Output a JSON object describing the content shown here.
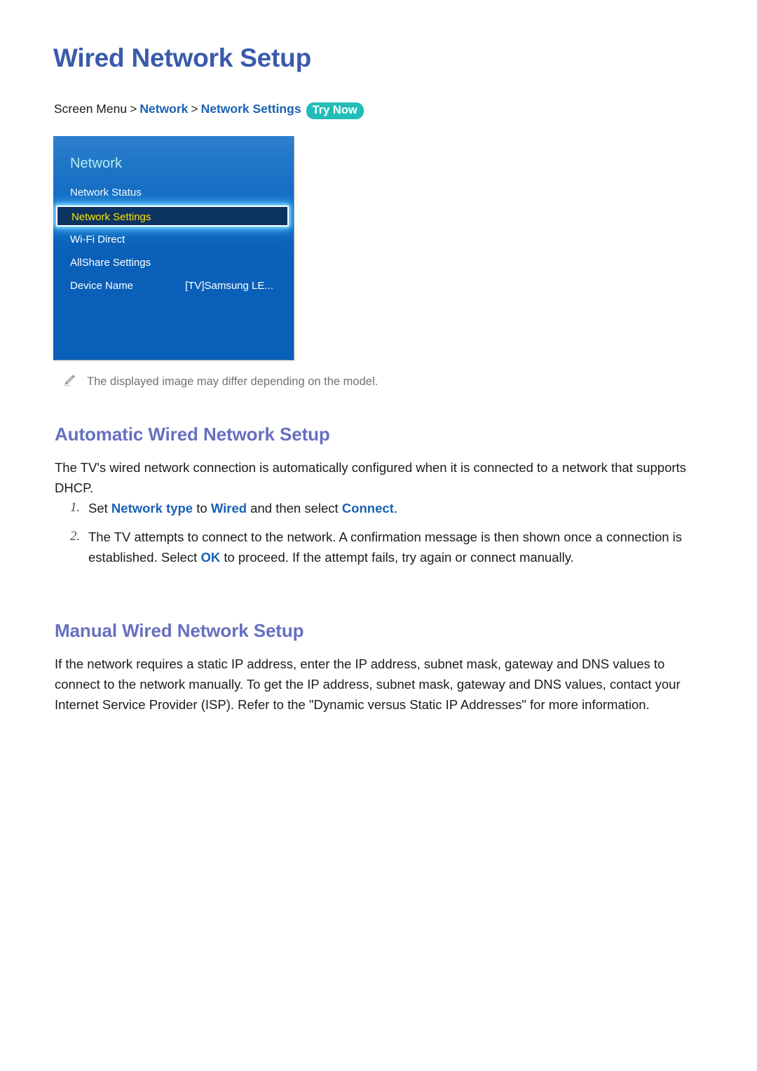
{
  "document": {
    "title": "Wired Network Setup"
  },
  "breadcrumb": {
    "root": "Screen Menu",
    "separator": ">",
    "level1": "Network",
    "level2": "Network Settings",
    "badge": "Try Now",
    "badge_color": "#23bdb8"
  },
  "tv_menu": {
    "header": "Network",
    "header_color": "#b8ecef",
    "background_top_color": "#2f80cf",
    "background_bottom_color": "#0a60b8",
    "selected_text_color": "#ffe400",
    "selected_fill_color": "#0c3362",
    "items": [
      {
        "label": "Network Status",
        "value": "",
        "selected": false
      },
      {
        "label": "Network Settings",
        "value": "",
        "selected": true
      },
      {
        "label": "Wi-Fi Direct",
        "value": "",
        "selected": false
      },
      {
        "label": "AllShare Settings",
        "value": "",
        "selected": false
      },
      {
        "label": "Device Name",
        "value": "[TV]Samsung LE...",
        "selected": false
      }
    ]
  },
  "note": {
    "icon": "pencil-icon",
    "text": "The displayed image may differ depending on the model."
  },
  "sections": {
    "automatic": {
      "heading": "Automatic Wired Network Setup",
      "heading_color": "#6670c0",
      "paragraph_plain": "The TV's wired network connection is automatically configured when it is connected to a network that supports DHCP.",
      "steps": [
        {
          "number": "1.",
          "parts": [
            {
              "text": "Set ",
              "highlight": false
            },
            {
              "text": "Network type",
              "highlight": true
            },
            {
              "text": " to ",
              "highlight": false
            },
            {
              "text": "Wired",
              "highlight": true
            },
            {
              "text": " and then select ",
              "highlight": false
            },
            {
              "text": "Connect",
              "highlight": true
            },
            {
              "text": ".",
              "highlight": false
            }
          ]
        },
        {
          "number": "2.",
          "parts": [
            {
              "text": "The TV attempts to connect to the network. A confirmation message is then shown once a connection is established. Select ",
              "highlight": false
            },
            {
              "text": "OK",
              "highlight": true
            },
            {
              "text": " to proceed. If the attempt fails, try again or connect manually.",
              "highlight": false
            }
          ]
        }
      ]
    },
    "manual": {
      "heading": "Manual Wired Network Setup",
      "heading_color": "#6670c0",
      "paragraph_plain": "If the network requires a static IP address, enter the IP address, subnet mask, gateway and DNS values to connect to the network manually. To get the IP address, subnet mask, gateway and DNS values, contact your Internet Service Provider (ISP). Refer to the \"Dynamic versus Static IP Addresses\" for more information."
    }
  },
  "theme": {
    "title_color": "#3a5aab",
    "link_color": "#1a62b5",
    "body_color": "#1c1c1c",
    "note_color": "#6f7377"
  }
}
